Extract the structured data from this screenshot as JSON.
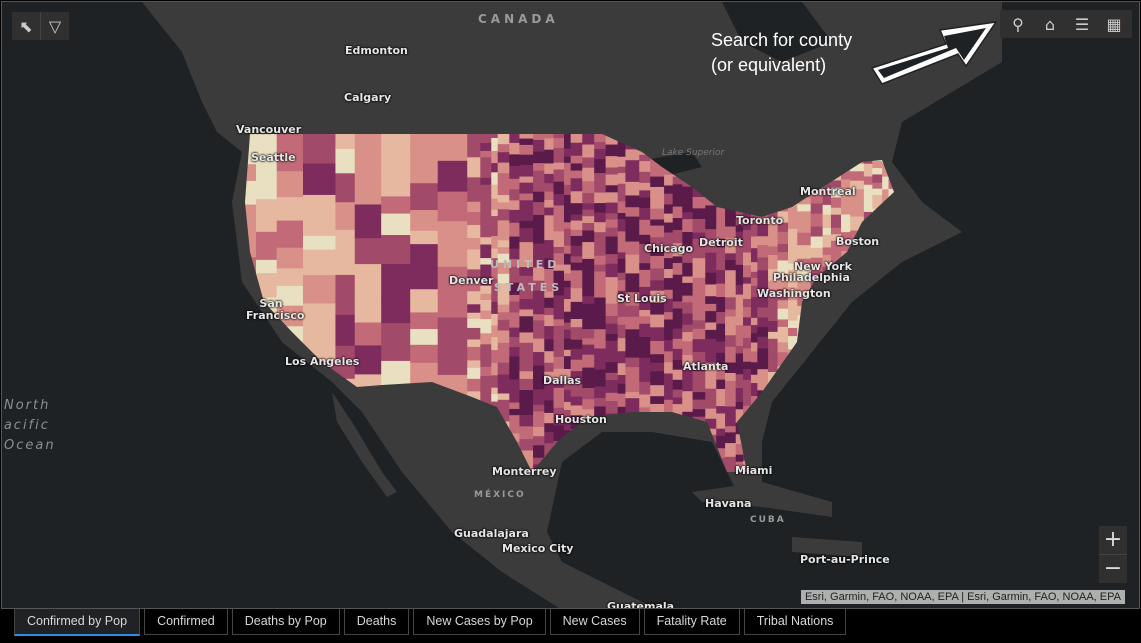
{
  "map": {
    "colors": {
      "water": "#1e2224",
      "land": "#3b3b3b",
      "choropleth": [
        "#e8e0c0",
        "#e7b8a0",
        "#d99088",
        "#c26a78",
        "#a24a6a",
        "#7e2c5e",
        "#5a1a4a"
      ]
    },
    "countries": {
      "canada": "CANADA",
      "usa_line1": "UNITED",
      "usa_line2": "STATES",
      "mexico": "MÉXICO",
      "cuba": "CUBA"
    },
    "ocean": {
      "line1": "North",
      "line2": "Pacific",
      "line3": "Ocean"
    },
    "lake_superior": "Lake Superior",
    "cities": [
      "Edmonton",
      "Calgary",
      "Vancouver",
      "Seattle",
      "Montreal",
      "Toronto",
      "Boston",
      "Detroit",
      "Chicago",
      "New York",
      "Philadelphia",
      "Washington",
      "Denver",
      "St Louis",
      "San Francisco",
      "Los Angeles",
      "Dallas",
      "Atlanta",
      "Houston",
      "Monterrey",
      "Miami",
      "Havana",
      "Guadalajara",
      "Mexico City",
      "Port-au-Prince",
      "Guatemala"
    ]
  },
  "toolbar_left": {
    "icons": [
      "select-icon",
      "dropdown-icon"
    ]
  },
  "toolbar_right": {
    "icons": [
      "search-icon",
      "home-icon",
      "legend-icon",
      "basemap-gallery-icon"
    ]
  },
  "annotation": {
    "line1": "Search for county",
    "line2": "(or equivalent)"
  },
  "zoom": {
    "in": "+",
    "out": "−"
  },
  "attribution": "Esri, Garmin, FAO, NOAA, EPA | Esri, Garmin, FAO, NOAA, EPA",
  "tabs": [
    {
      "label": "Confirmed by Pop",
      "active": true
    },
    {
      "label": "Confirmed"
    },
    {
      "label": "Deaths by Pop"
    },
    {
      "label": "Deaths"
    },
    {
      "label": "New Cases by Pop"
    },
    {
      "label": "New Cases"
    },
    {
      "label": "Fatality Rate"
    },
    {
      "label": "Tribal Nations"
    }
  ]
}
